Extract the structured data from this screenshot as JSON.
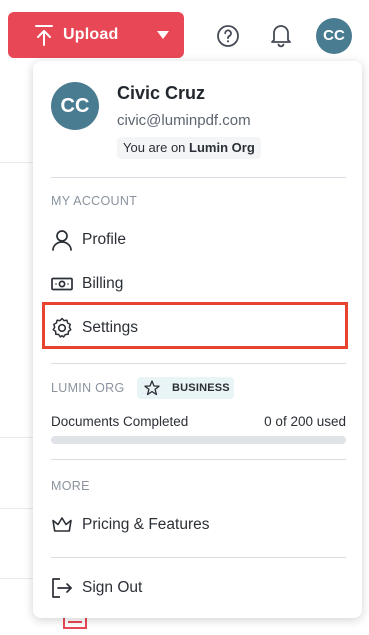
{
  "topbar": {
    "upload_label": "Upload",
    "avatar_initials": "CC"
  },
  "account": {
    "initials": "CC",
    "name": "Civic Cruz",
    "email": "civic@luminpdf.com",
    "org_prefix": "You are on",
    "org_name": "Lumin Org"
  },
  "sections": {
    "my_account": "MY ACCOUNT",
    "org": "LUMIN ORG",
    "more": "MORE"
  },
  "menu": {
    "profile": "Profile",
    "billing": "Billing",
    "settings": "Settings",
    "pricing": "Pricing & Features",
    "signout": "Sign Out"
  },
  "plan": {
    "badge": "BUSINESS",
    "docs_label": "Documents Completed",
    "docs_count": "0 of 200 used",
    "docs_used_fraction": 0
  },
  "colors": {
    "brand_red": "#e84855",
    "avatar": "#4a7c91",
    "highlight": "#e8432f"
  }
}
